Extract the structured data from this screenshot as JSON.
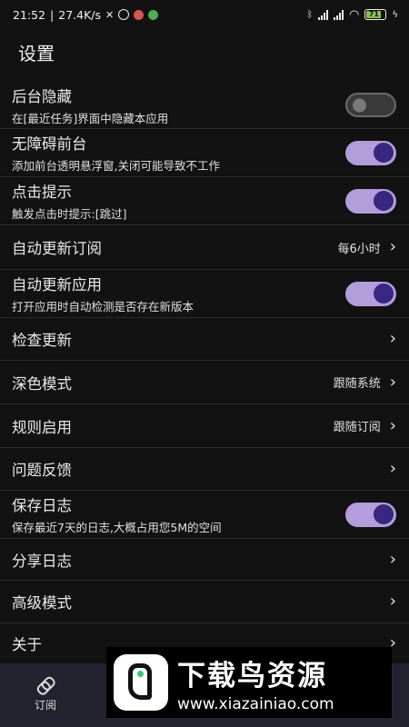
{
  "status_bar": {
    "time": "21:52",
    "speed": "27.4K/s",
    "battery": "71"
  },
  "header": {
    "title": "设置"
  },
  "settings": [
    {
      "title": "后台隐藏",
      "subtitle": "在[最近任务]界面中隐藏本应用",
      "toggle": false
    },
    {
      "title": "无障碍前台",
      "subtitle": "添加前台透明悬浮窗,关闭可能导致不工作",
      "toggle": true
    },
    {
      "title": "点击提示",
      "subtitle": "触发点击时提示:[跳过]",
      "toggle": true
    },
    {
      "title": "自动更新订阅",
      "value": "每6小时"
    },
    {
      "title": "自动更新应用",
      "subtitle": "打开应用时自动检测是否存在新版本",
      "toggle": true
    },
    {
      "title": "检查更新"
    },
    {
      "title": "深色模式",
      "value": "跟随系统"
    },
    {
      "title": "规则启用",
      "value": "跟随订阅"
    },
    {
      "title": "问题反馈"
    },
    {
      "title": "保存日志",
      "subtitle": "保存最近7天的日志,大概占用您5M的空间",
      "toggle": true
    },
    {
      "title": "分享日志"
    },
    {
      "title": "高级模式"
    },
    {
      "title": "关于"
    }
  ],
  "bottom_nav": {
    "items": [
      {
        "label": "订阅",
        "icon": "link-icon"
      }
    ]
  },
  "watermark": {
    "title": "下载鸟资源",
    "url": "www.xiazainiao.com"
  },
  "colors": {
    "background": "#121212",
    "toggle_on": "#b39ddb",
    "knob_on": "#3a2580",
    "nav_bg": "#232330"
  }
}
